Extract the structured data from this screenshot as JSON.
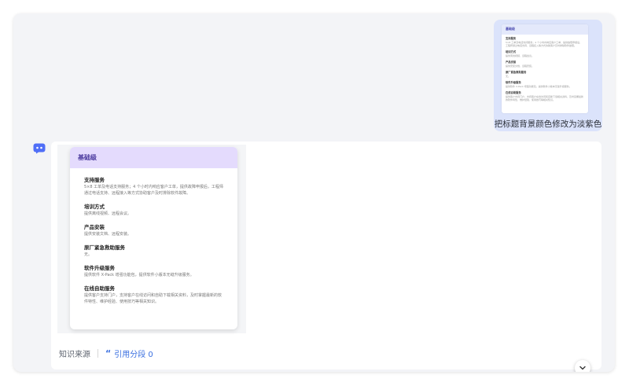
{
  "user_message": {
    "text": "把标题背景颜色修改为淡紫色",
    "thumbnail": {
      "title": "基础级",
      "sections": [
        {
          "title": "支持服务",
          "desc": "5×8 工单及电话支持服务；4 个小时内响应客户工单，提供故障申报后，工程师通过电话支持、远程接入等方式协助客户及时排除软件故障。"
        },
        {
          "title": "培训方式",
          "desc": "提供离线视频、远程会议。"
        },
        {
          "title": "产品安装",
          "desc": "提供安装文档、远程安装。"
        },
        {
          "title": "原厂紧急救助服务",
          "desc": "无。"
        },
        {
          "title": "软件升级服务",
          "desc": "提供软件 X-Pack 增强功能包，提供软件小版本无缝升级服务。"
        },
        {
          "title": "在线自助服务",
          "desc": "提供客户支持门户，支持客户在线访问和自助下载相关资料，及时掌握最新的软件特性、维护经验、使用技巧等相关知识。"
        }
      ]
    }
  },
  "assistant_message": {
    "doc_title": "基础级",
    "sections": [
      {
        "title": "支持服务",
        "desc": "5×8 工单及电话支持服务；4 个小时内响应客户工单，提供故障申报后，工程师通过电话支持、远程接入等方式协助客户及时排除软件故障。"
      },
      {
        "title": "培训方式",
        "desc": "提供离线视频、远程会议。"
      },
      {
        "title": "产品安装",
        "desc": "提供安装文档、远程安装。"
      },
      {
        "title": "原厂紧急救助服务",
        "desc": "无。"
      },
      {
        "title": "软件升级服务",
        "desc": "提供软件 X-Pack 增强功能包，提供软件小版本无缝升级服务。"
      },
      {
        "title": "在线自助服务",
        "desc": "提供客户支持门户，支持客户在线访问和自助下载相关资料，及时掌握最新的软件特性、维护经验、使用技巧等相关知识。"
      }
    ],
    "sources_label": "知识来源",
    "citation_label": "引用分段 0"
  },
  "colors": {
    "accent": "#3b70e0",
    "title_bg": "#e4dbfd",
    "user_bubble": "#dbe3fb"
  },
  "icons": {
    "bot": "robot-chat-icon",
    "quote": "quote-icon",
    "scroll": "chevron-down-icon"
  }
}
